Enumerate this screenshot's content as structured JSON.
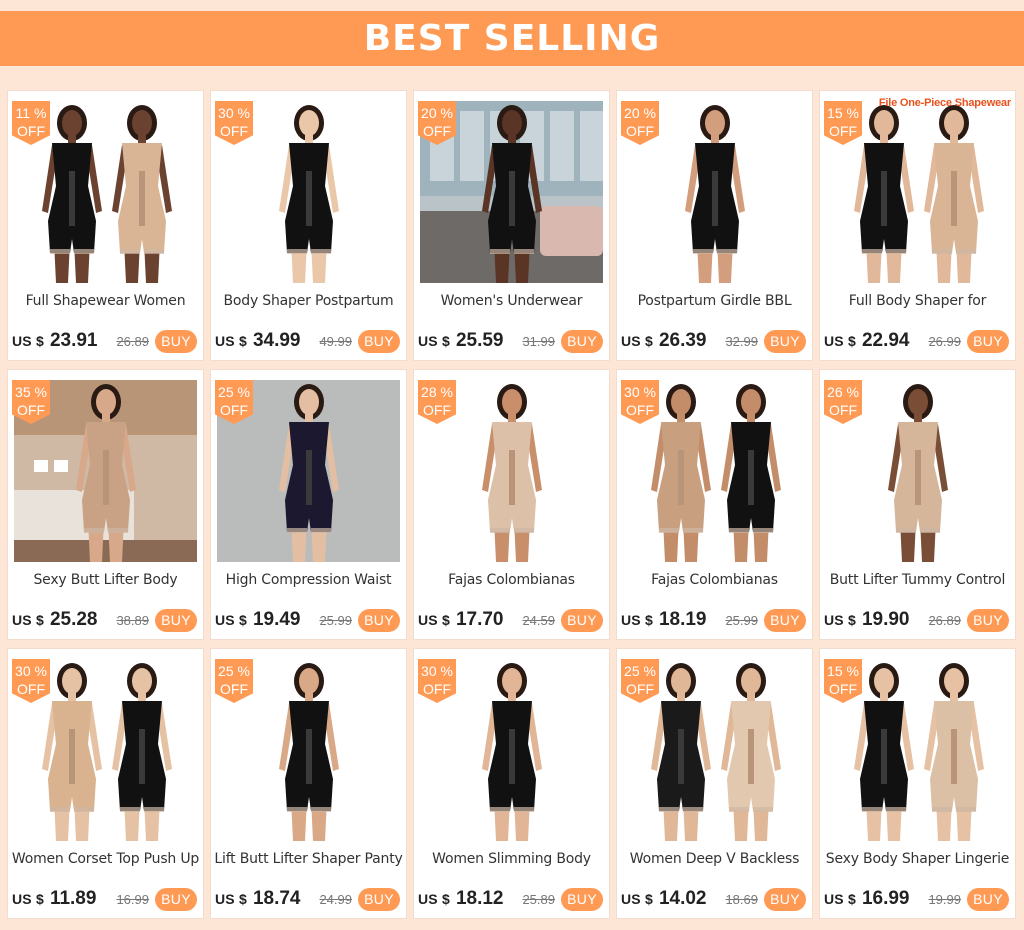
{
  "header": {
    "title": "BEST SELLING"
  },
  "buy_label": "BUY",
  "currency_label": "US $",
  "colors": {
    "accent": "#ff9a55",
    "background": "#fde6d6",
    "card": "#ffffff"
  },
  "products": [
    {
      "discount_value": "11",
      "discount_unit": "%",
      "discount_label": "OFF",
      "title": "Full Shapewear Women",
      "price": "23.91",
      "original_price": "26.89",
      "image_caption": "",
      "scene": "studio",
      "garment": "#111111",
      "garment2": "#d9b596",
      "skin": "#6b4230",
      "models": 2
    },
    {
      "discount_value": "30",
      "discount_unit": "%",
      "discount_label": "OFF",
      "title": "Body Shaper Postpartum",
      "price": "34.99",
      "original_price": "49.99",
      "image_caption": "",
      "scene": "studio",
      "garment": "#111111",
      "garment2": "#111111",
      "skin": "#e9c7a8",
      "models": 1
    },
    {
      "discount_value": "20",
      "discount_unit": "%",
      "discount_label": "OFF",
      "title": "Women's Underwear",
      "price": "25.59",
      "original_price": "31.99",
      "image_caption": "",
      "scene": "room",
      "garment": "#111111",
      "garment2": "#111111",
      "skin": "#5a3424",
      "models": 1
    },
    {
      "discount_value": "20",
      "discount_unit": "%",
      "discount_label": "OFF",
      "title": "Postpartum Girdle BBL",
      "price": "26.39",
      "original_price": "32.99",
      "image_caption": "",
      "scene": "studio",
      "garment": "#111111",
      "garment2": "#111111",
      "skin": "#d29e7d",
      "models": 1
    },
    {
      "discount_value": "15",
      "discount_unit": "%",
      "discount_label": "OFF",
      "title": "Full Body Shaper for",
      "price": "22.94",
      "original_price": "26.99",
      "image_caption": "File One-Piece Shapewear",
      "scene": "studio",
      "garment": "#111111",
      "garment2": "#d9b596",
      "skin": "#e2b89a",
      "models": 2
    },
    {
      "discount_value": "35",
      "discount_unit": "%",
      "discount_label": "OFF",
      "title": "Sexy Butt Lifter Body",
      "price": "25.28",
      "original_price": "38.89",
      "image_caption": "",
      "scene": "bedroom",
      "garment": "#c9a285",
      "garment2": "#c9a285",
      "skin": "#d8a88a",
      "models": 1
    },
    {
      "discount_value": "25",
      "discount_unit": "%",
      "discount_label": "OFF",
      "title": "High Compression Waist",
      "price": "19.49",
      "original_price": "25.99",
      "image_caption": "",
      "scene": "grey",
      "garment": "#1b1830",
      "garment2": "#1b1830",
      "skin": "#e4bea2",
      "models": 1
    },
    {
      "discount_value": "28",
      "discount_unit": "%",
      "discount_label": "OFF",
      "title": "Fajas Colombianas",
      "price": "17.70",
      "original_price": "24.59",
      "image_caption": "",
      "scene": "studio",
      "garment": "#dcc0a7",
      "garment2": "#dcc0a7",
      "skin": "#c98f6a",
      "models": 1
    },
    {
      "discount_value": "30",
      "discount_unit": "%",
      "discount_label": "OFF",
      "title": "Fajas Colombianas",
      "price": "18.19",
      "original_price": "25.99",
      "image_caption": "",
      "scene": "studio",
      "garment": "#c9a07f",
      "garment2": "#111111",
      "skin": "#c48d6a",
      "models": 2
    },
    {
      "discount_value": "26",
      "discount_unit": "%",
      "discount_label": "OFF",
      "title": "Butt Lifter Tummy Control",
      "price": "19.90",
      "original_price": "26.89",
      "image_caption": "",
      "scene": "studio",
      "garment": "#d5b69b",
      "garment2": "#d5b69b",
      "skin": "#7a4e36",
      "models": 1
    },
    {
      "discount_value": "30",
      "discount_unit": "%",
      "discount_label": "OFF",
      "title": "Women Corset Top Push Up",
      "price": "11.89",
      "original_price": "16.99",
      "image_caption": "",
      "scene": "studio",
      "garment": "#d9b38f",
      "garment2": "#111111",
      "skin": "#e6c2a5",
      "models": 2
    },
    {
      "discount_value": "25",
      "discount_unit": "%",
      "discount_label": "OFF",
      "title": "Lift Butt Lifter Shaper Panty",
      "price": "18.74",
      "original_price": "24.99",
      "image_caption": "",
      "scene": "studio",
      "garment": "#111111",
      "garment2": "#111111",
      "skin": "#d9a886",
      "models": 1
    },
    {
      "discount_value": "30",
      "discount_unit": "%",
      "discount_label": "OFF",
      "title": "Women Slimming Body",
      "price": "18.12",
      "original_price": "25.89",
      "image_caption": "",
      "scene": "studio",
      "garment": "#111111",
      "garment2": "#111111",
      "skin": "#e1b596",
      "models": 1
    },
    {
      "discount_value": "25",
      "discount_unit": "%",
      "discount_label": "OFF",
      "title": "Women Deep V Backless",
      "price": "14.02",
      "original_price": "18.69",
      "image_caption": "",
      "scene": "studio",
      "garment": "#1a1a1a",
      "garment2": "#e3c8b0",
      "skin": "#e0b898",
      "models": 2
    },
    {
      "discount_value": "15",
      "discount_unit": "%",
      "discount_label": "OFF",
      "title": "Sexy Body Shaper Lingerie",
      "price": "16.99",
      "original_price": "19.99",
      "image_caption": "",
      "scene": "studio",
      "garment": "#111111",
      "garment2": "#dcc0a5",
      "skin": "#e6c1a3",
      "models": 2
    }
  ]
}
